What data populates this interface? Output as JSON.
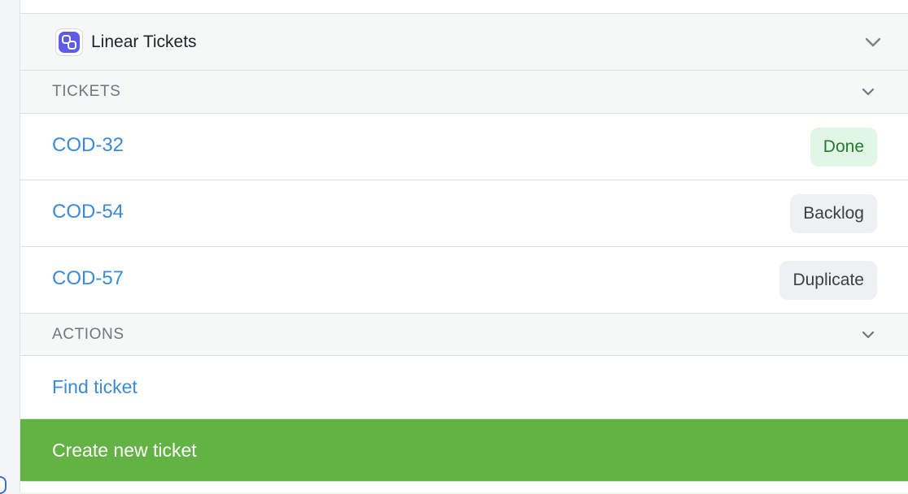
{
  "header": {
    "title": "Linear Tickets",
    "icon": "linear-app-icon",
    "accent": "#5e5ce6"
  },
  "tickets_section": {
    "title": "TICKETS",
    "items": [
      {
        "id": "COD-32",
        "status": "Done"
      },
      {
        "id": "COD-54",
        "status": "Backlog"
      },
      {
        "id": "COD-57",
        "status": "Duplicate"
      }
    ]
  },
  "actions_section": {
    "title": "ACTIONS",
    "find_label": "Find ticket",
    "create_label": "Create new ticket",
    "create_color": "#63b244"
  },
  "colors": {
    "link": "#3b8ad6",
    "done_bg": "#e2f6e5",
    "done_text": "#267a35",
    "neutral_bg": "#eef0f1"
  }
}
